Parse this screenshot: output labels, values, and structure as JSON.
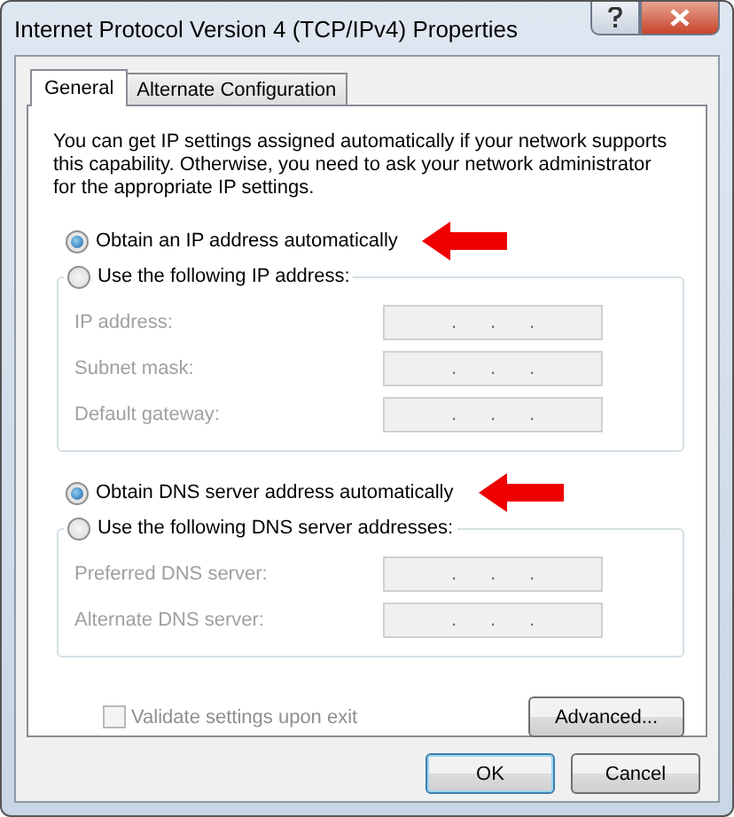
{
  "window": {
    "title": "Internet Protocol Version 4 (TCP/IPv4) Properties"
  },
  "tabs": [
    {
      "label": "General",
      "selected": true
    },
    {
      "label": "Alternate Configuration",
      "selected": false
    }
  ],
  "description": "You can get IP settings assigned automatically if your network supports this capability. Otherwise, you need to ask your network administrator for the appropriate IP settings.",
  "sections": [
    {
      "auto_option": {
        "label": "Obtain an IP address automatically",
        "selected": true,
        "annotated": true
      },
      "manual_option": {
        "label": "Use the following IP address:",
        "selected": false
      },
      "fields": [
        {
          "label": "IP address:",
          "separators": [
            ".",
            ".",
            "."
          ],
          "disabled": true
        },
        {
          "label": "Subnet mask:",
          "separators": [
            ".",
            ".",
            "."
          ],
          "disabled": true
        },
        {
          "label": "Default gateway:",
          "separators": [
            ".",
            ".",
            "."
          ],
          "disabled": true
        }
      ]
    },
    {
      "auto_option": {
        "label": "Obtain DNS server address automatically",
        "selected": true,
        "annotated": true
      },
      "manual_option": {
        "label": "Use the following DNS server addresses:",
        "selected": false
      },
      "fields": [
        {
          "label": "Preferred DNS server:",
          "separators": [
            ".",
            ".",
            "."
          ],
          "disabled": true
        },
        {
          "label": "Alternate DNS server:",
          "separators": [
            ".",
            ".",
            "."
          ],
          "disabled": true
        }
      ]
    }
  ],
  "validate_checkbox": {
    "label": "Validate settings upon exit",
    "checked": false,
    "disabled": true
  },
  "advanced_button": "Advanced...",
  "buttons": [
    {
      "label": "OK",
      "default": true
    },
    {
      "label": "Cancel",
      "default": false
    }
  ]
}
